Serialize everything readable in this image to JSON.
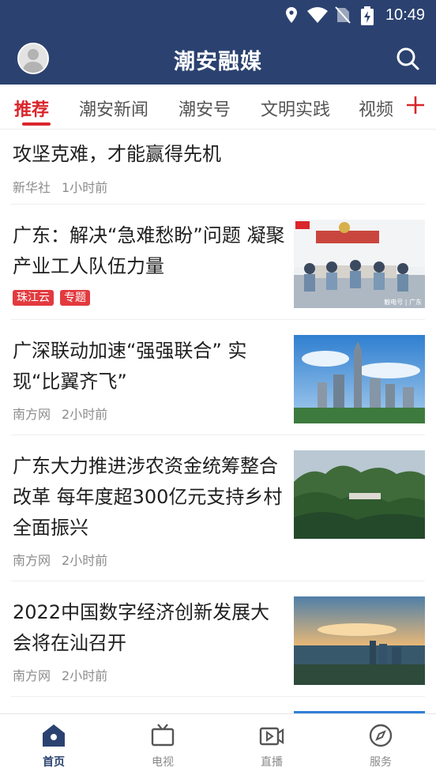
{
  "status_bar": {
    "time": "10:49",
    "icons": [
      "location-icon",
      "wifi-icon",
      "no-sim-icon",
      "battery-charging-icon"
    ]
  },
  "header": {
    "title": "潮安融媒",
    "avatar_icon": "user-avatar-icon",
    "search_icon": "search-icon"
  },
  "colors": {
    "header_bg": "#2b4270",
    "accent": "#d9252b",
    "tag_bg": "#e23a3f"
  },
  "tabs": [
    {
      "label": "推荐",
      "active": true
    },
    {
      "label": "潮安新闻",
      "active": false
    },
    {
      "label": "潮安号",
      "active": false
    },
    {
      "label": "文明实践",
      "active": false
    },
    {
      "label": "视频",
      "active": false
    }
  ],
  "tab_add_icon": "plus-icon",
  "news": [
    {
      "title": "攻坚克难，才能赢得先机",
      "source": "新华社",
      "time": "1小时前"
    },
    {
      "title": "广东：解决“急难愁盼”问题 凝聚产业工人队伍力量",
      "tags": [
        "珠江云",
        "专题"
      ],
      "image_caption": "触电号 | 广东"
    },
    {
      "title": "广深联动加速“强强联合” 实现“比翼齐飞”",
      "source": "南方网",
      "time": "2小时前"
    },
    {
      "title": "广东大力推进涉农资金统筹整合改革 每年度超300亿元支持乡村全面振兴",
      "source": "南方网",
      "time": "2小时前"
    },
    {
      "title": "2022中国数字经济创新发展大会将在汕召开",
      "source": "南方网",
      "time": "2小时前"
    }
  ],
  "bottom_nav": [
    {
      "label": "首页",
      "icon": "home-icon",
      "active": true
    },
    {
      "label": "电视",
      "icon": "tv-icon",
      "active": false
    },
    {
      "label": "直播",
      "icon": "live-video-icon",
      "active": false
    },
    {
      "label": "服务",
      "icon": "compass-icon",
      "active": false
    }
  ]
}
